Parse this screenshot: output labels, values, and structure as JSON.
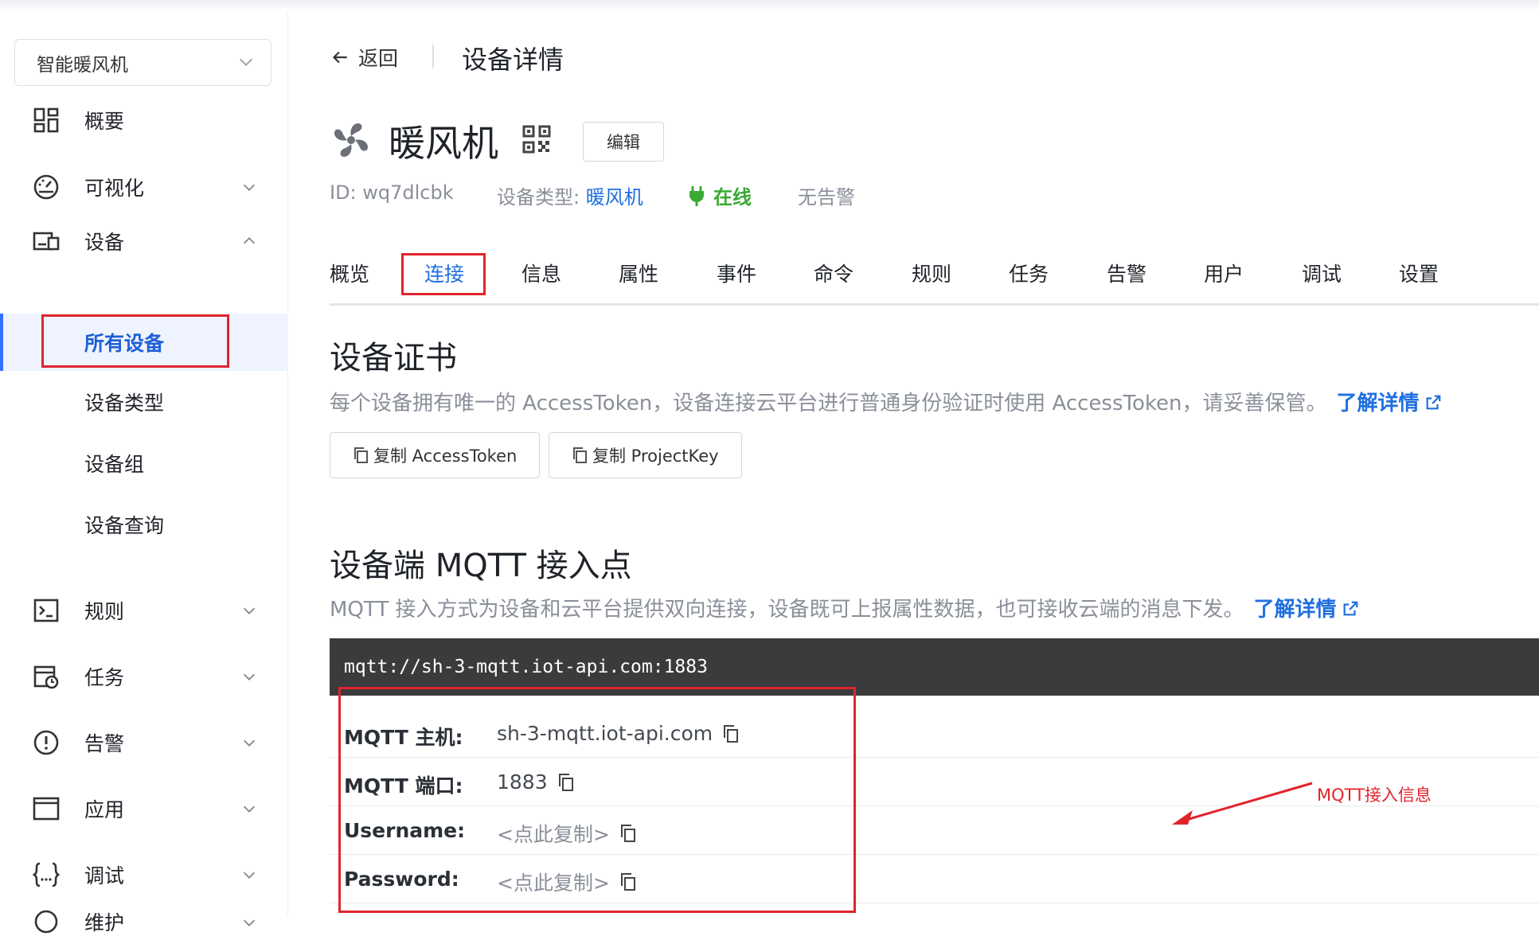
{
  "sidebar": {
    "project": "智能暖风机",
    "nav": {
      "overview": "概要",
      "visualize": "可视化",
      "devices": "设备",
      "rules": "规则",
      "tasks": "任务",
      "alarms": "告警",
      "apps": "应用",
      "debug": "调试",
      "maintain": "维护"
    },
    "device_sub": {
      "all": "所有设备",
      "types": "设备类型",
      "groups": "设备组",
      "query": "设备查询"
    }
  },
  "header": {
    "back": "返回",
    "title": "设备详情"
  },
  "device": {
    "name": "暖风机",
    "edit": "编辑",
    "id": "ID: wq7dlcbk",
    "type_label": "设备类型: ",
    "type_value": "暖风机",
    "status": "在线",
    "alarm": "无告警"
  },
  "tabs": [
    "概览",
    "连接",
    "信息",
    "属性",
    "事件",
    "命令",
    "规则",
    "任务",
    "告警",
    "用户",
    "调试",
    "设置"
  ],
  "active_tab": "连接",
  "certificate": {
    "title": "设备证书",
    "desc": "每个设备拥有唯一的 AccessToken，设备连接云平台进行普通身份验证时使用 AccessToken，请妥善保管。",
    "more": "了解详情",
    "copy_token": "复制 AccessToken",
    "copy_projectkey": "复制 ProjectKey"
  },
  "mqtt": {
    "title": "设备端 MQTT 接入点",
    "desc": "MQTT 接入方式为设备和云平台提供双向连接，设备既可上报属性数据，也可接收云端的消息下发。",
    "more": "了解详情",
    "url": "mqtt://sh-3-mqtt.iot-api.com:1883",
    "rows": [
      {
        "key": "MQTT 主机:",
        "value": "sh-3-mqtt.iot-api.com"
      },
      {
        "key": "MQTT 端口:",
        "value": "1883"
      },
      {
        "key": "Username:",
        "value": "<点此复制>"
      },
      {
        "key": "Password:",
        "value": "<点此复制>"
      }
    ]
  },
  "annotation": "MQTT接入信息",
  "colors": {
    "accent": "#1f6fe0",
    "online": "#3aaa35",
    "highlight": "#e0242d",
    "code_bg": "#3a3b3d"
  }
}
